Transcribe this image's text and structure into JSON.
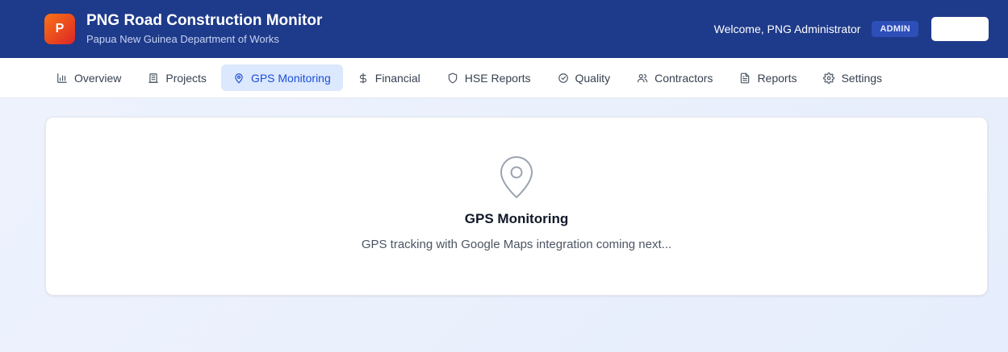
{
  "header": {
    "logo_letter": "P",
    "title": "PNG Road Construction Monitor",
    "subtitle": "Papua New Guinea Department of Works",
    "welcome": "Welcome, PNG Administrator",
    "role_badge": "ADMIN",
    "button_label": ""
  },
  "nav": {
    "items": [
      {
        "label": "Overview",
        "icon": "bar-chart-icon"
      },
      {
        "label": "Projects",
        "icon": "building-icon"
      },
      {
        "label": "GPS Monitoring",
        "icon": "map-pin-icon",
        "active": true
      },
      {
        "label": "Financial",
        "icon": "dollar-icon"
      },
      {
        "label": "HSE Reports",
        "icon": "shield-icon"
      },
      {
        "label": "Quality",
        "icon": "check-circle-icon"
      },
      {
        "label": "Contractors",
        "icon": "users-icon"
      },
      {
        "label": "Reports",
        "icon": "file-text-icon"
      },
      {
        "label": "Settings",
        "icon": "gear-icon"
      }
    ]
  },
  "main": {
    "icon": "map-pin-icon",
    "title": "GPS Monitoring",
    "description": "GPS tracking with Google Maps integration coming next..."
  },
  "colors": {
    "header_bg": "#1e3a8a",
    "accent": "#1d4ed8",
    "active_tab_bg": "#dbe8fd",
    "logo_gradient": [
      "#f97316",
      "#dc2626"
    ]
  }
}
